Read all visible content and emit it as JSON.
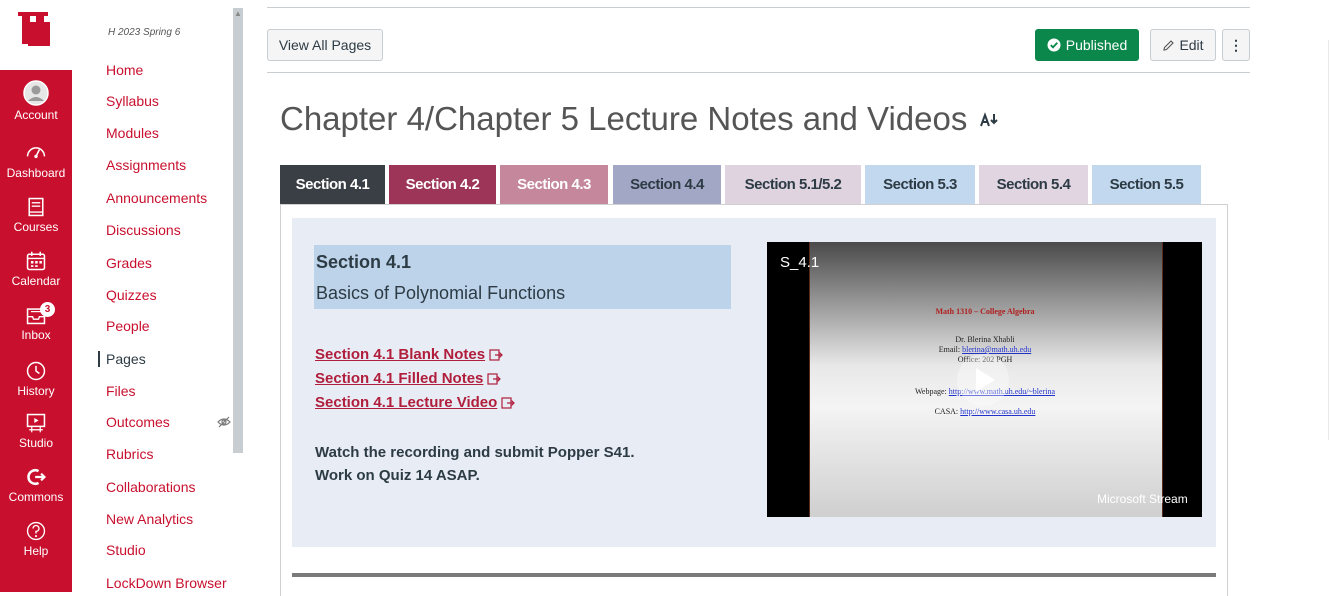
{
  "global_nav": {
    "logo_text": "UH",
    "items": [
      {
        "label": "Account",
        "icon": "account-icon"
      },
      {
        "label": "Dashboard",
        "icon": "dashboard-icon"
      },
      {
        "label": "Courses",
        "icon": "courses-icon"
      },
      {
        "label": "Calendar",
        "icon": "calendar-icon"
      },
      {
        "label": "Inbox",
        "icon": "inbox-icon",
        "badge": "3"
      },
      {
        "label": "History",
        "icon": "history-icon"
      },
      {
        "label": "Studio",
        "icon": "studio-icon"
      },
      {
        "label": "Commons",
        "icon": "commons-icon"
      },
      {
        "label": "Help",
        "icon": "help-icon"
      }
    ]
  },
  "course_nav": {
    "term": "H 2023 Spring 6",
    "items": [
      "Home",
      "Syllabus",
      "Modules",
      "Assignments",
      "Announcements",
      "Discussions",
      "Grades",
      "Quizzes",
      "People",
      "Pages",
      "Files",
      "Outcomes",
      "Rubrics",
      "Collaborations",
      "New Analytics",
      "Studio",
      "LockDown Browser"
    ],
    "active": "Pages"
  },
  "toolbar": {
    "view_all_pages": "View All Pages",
    "published": "Published",
    "edit": "Edit",
    "more": "⋮"
  },
  "page": {
    "title": "Chapter 4/Chapter 5 Lecture Notes and Videos"
  },
  "tabs": [
    {
      "label": "Section 4.1",
      "bg": "#3a3f45",
      "fg": "#ffffff"
    },
    {
      "label": "Section 4.2",
      "bg": "#9c3558",
      "fg": "#ffffff"
    },
    {
      "label": "Section 4.3",
      "bg": "#c4879c",
      "fg": "#ffffff"
    },
    {
      "label": "Section 4.4",
      "bg": "#a3a7c6",
      "fg": "#2d3b45"
    },
    {
      "label": "Section 5.1/5.2",
      "bg": "#ded3df",
      "fg": "#2d3b45"
    },
    {
      "label": "Section 5.3",
      "bg": "#c2d8ee",
      "fg": "#2d3b45"
    },
    {
      "label": "Section 5.4",
      "bg": "#e1d5e2",
      "fg": "#2d3b45"
    },
    {
      "label": "Section 5.5",
      "bg": "#c2d8ee",
      "fg": "#2d3b45"
    }
  ],
  "section": {
    "number": "Section 4.1",
    "subtitle": "Basics of Polynomial Functions",
    "links": [
      "Section 4.1 Blank Notes",
      "Section 4.1 Filled Notes",
      "Section 4.1 Lecture Video"
    ],
    "instructions": [
      "Watch the recording and submit Popper S41.",
      "Work on Quiz 14 ASAP."
    ]
  },
  "video": {
    "title": "S_4.1",
    "slide_heading": "Math 1310 – College Algebra",
    "slide_name": "Dr. Blerina Xhabli",
    "slide_email_prefix": "Email: ",
    "slide_email": "blerina@math.uh.edu",
    "slide_office": "Office: 202 PGH",
    "slide_webpage_prefix": "Webpage: ",
    "slide_webpage": "http://www.math.uh.edu/~blerina",
    "slide_casa_prefix": "CASA: ",
    "slide_casa": "http://www.casa.uh.edu",
    "provider": "Microsoft Stream"
  },
  "colors": {
    "brand_red": "#c8102e",
    "published_green": "#0b874b",
    "link_red": "#b01e3c"
  }
}
